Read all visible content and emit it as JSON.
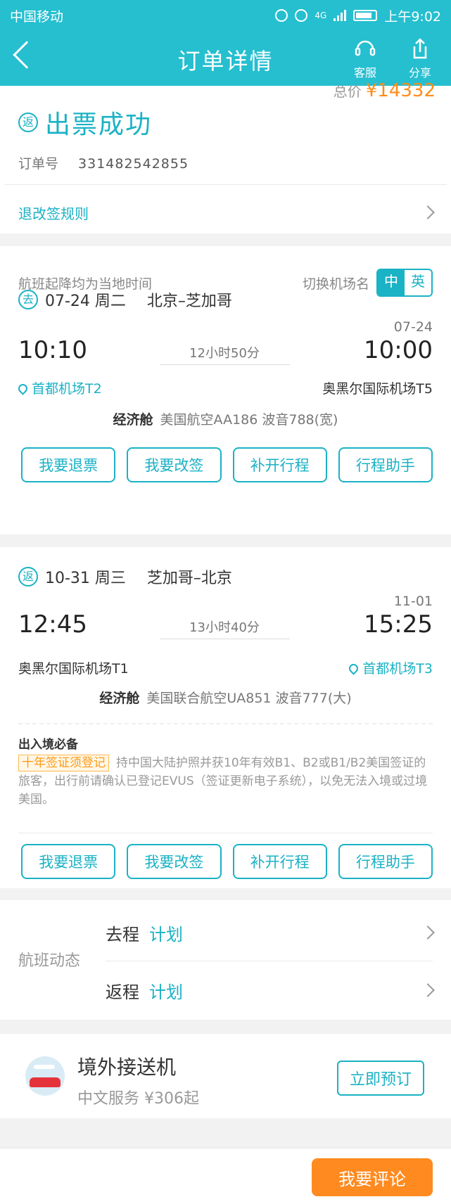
{
  "status_bar": {
    "carrier": "中国移动",
    "net": "4G",
    "time": "上午9:02"
  },
  "header": {
    "title": "订单详情",
    "service_label": "客服",
    "share_label": "分享"
  },
  "order": {
    "total_label": "总价",
    "total_value": "¥14332",
    "status_icon": "返",
    "status_text": "出票成功",
    "order_no_label": "订单号",
    "order_no": "331482542855",
    "rules_link": "退改签规则"
  },
  "flights_section": {
    "timezone_note": "航班起降均为当地时间",
    "switch_label": "切换机场名",
    "lang_cn": "中",
    "lang_en": "英"
  },
  "outbound": {
    "direction_icon": "去",
    "date": "07-24 周二",
    "route": "北京–芝加哥",
    "arrival_date": "07-24",
    "dep_time": "10:10",
    "duration": "12小时50分",
    "arr_time": "10:00",
    "dep_airport": "首都机场T2",
    "arr_airport": "奥黑尔国际机场T5",
    "cabin": "经济舱",
    "flight_info": "美国航空AA186  波音788(宽)",
    "actions": [
      "我要退票",
      "我要改签",
      "补开行程",
      "行程助手"
    ]
  },
  "return": {
    "direction_icon": "返",
    "date": "10-31 周三",
    "route": "芝加哥–北京",
    "arrival_date": "11-01",
    "dep_time": "12:45",
    "duration": "13小时40分",
    "arr_time": "15:25",
    "dep_airport": "奥黑尔国际机场T1",
    "arr_airport": "首都机场T3",
    "cabin": "经济舱",
    "flight_info": "美国联合航空UA851  波音777(大)",
    "notice_title": "出入境必备",
    "notice_badge": "十年签证须登记",
    "notice_text": "持中国大陆护照并获10年有效B1、B2或B1/B2美国签证的旅客，出行前请确认已登记EVUS（签证更新电子系统），以免无法入境或过境美国。",
    "actions": [
      "我要退票",
      "我要改签",
      "补开行程",
      "行程助手"
    ]
  },
  "dynamics": {
    "label": "航班动态",
    "rows": [
      {
        "leg": "去程",
        "status": "计划"
      },
      {
        "leg": "返程",
        "status": "计划"
      }
    ]
  },
  "transfer": {
    "title": "境外接送机",
    "subtitle": "中文服务 ¥306起",
    "button": "立即预订"
  },
  "bottom": {
    "review_button": "我要评论"
  }
}
